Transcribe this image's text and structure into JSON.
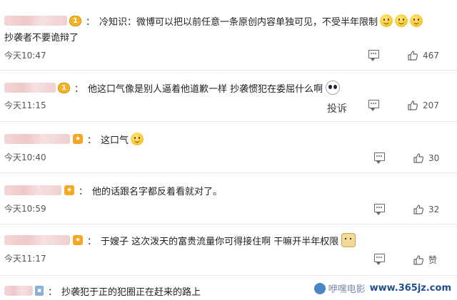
{
  "comments": [
    {
      "level": "1",
      "text_line1": "冷知识：微博可以把以前任意一条原创内容单独可见，不受半年限制",
      "text_line2": "抄袭者不要诡辩了",
      "time": "今天10:47",
      "likes": "467",
      "emoji": "smile-emoji"
    },
    {
      "level": "1",
      "text_line1": "他这口气像是别人逼着他道歉一样 抄袭惯犯在委屈什么啊",
      "time": "今天11:15",
      "likes": "207",
      "report_label": "投诉"
    },
    {
      "text_line1": "这口气",
      "time": "今天10:40",
      "likes": "30"
    },
    {
      "text_line1": "他的话跟名字都反着看就对了。",
      "time": "今天10:59",
      "likes": "32"
    },
    {
      "text_line1": "于嫂子 这次泼天的富贵流量你可得接住啊 干嘛开半年权限",
      "time": "今天11:17",
      "likes": "赞"
    },
    {
      "text_line1": "抄袭犯于正的犯圈正在赶来的路上"
    }
  ],
  "separator": "：",
  "watermark": {
    "name": "咿嘿电影",
    "url": "www.365jz.com"
  },
  "colors": {
    "accent": "#f2b224",
    "text": "#222222",
    "meta": "#555555"
  },
  "icons": {
    "comment": "comment-icon",
    "like": "thumbs-up-icon"
  }
}
